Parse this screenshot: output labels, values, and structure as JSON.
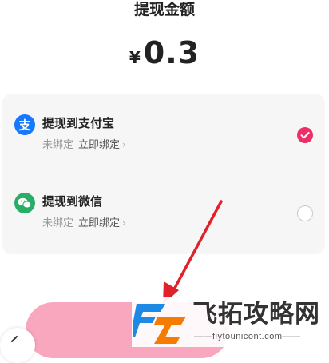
{
  "header": {
    "title": "提现金额",
    "currency_symbol": "¥",
    "amount": "0.3"
  },
  "options": [
    {
      "title": "提现到支付宝",
      "status": "未绑定",
      "bind_action": "立即绑定",
      "chevron": "›",
      "icon": "alipay-icon",
      "icon_color": "#1677ff",
      "selected": true
    },
    {
      "title": "提现到微信",
      "status": "未绑定",
      "bind_action": "立即绑定",
      "chevron": "›",
      "icon": "wechat-icon",
      "icon_color": "#2aae67",
      "selected": false
    }
  ],
  "colors": {
    "accent": "#ee2f67",
    "button": "#f9a6bf",
    "card_bg": "#f6f6f6",
    "arrow": "#e0202a"
  },
  "watermark": {
    "text": "飞拓攻略网",
    "subtext": "——fiytounicont.com——"
  }
}
